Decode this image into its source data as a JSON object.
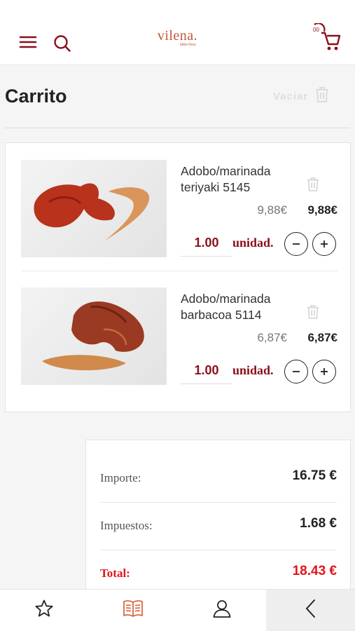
{
  "header": {
    "logo_text": "vilena.",
    "logo_sub": "fabio fresc",
    "cart_count": "00",
    "brand_color": "#8a0f1a",
    "logo_color": "#c2553b"
  },
  "cart": {
    "title": "Carrito",
    "empty_label": "Vaciar",
    "items": [
      {
        "name": "Adobo/marinada teriyaki 5145",
        "old_price": "9,88€",
        "price": "9,88€",
        "quantity": "1.00",
        "unit": "unidad."
      },
      {
        "name": "Adobo/marinada barbacoa 5114",
        "old_price": "6,87€",
        "price": "6,87€",
        "quantity": "1.00",
        "unit": "unidad."
      }
    ]
  },
  "summary": {
    "importe_label": "Importe:",
    "importe_value": "16.75 €",
    "impuestos_label": "Impuestos:",
    "impuestos_value": "1.68 €",
    "total_label": "Total:",
    "total_value": "18.43 €",
    "total_color": "#e2141b"
  },
  "nav": {
    "items": [
      "star-icon",
      "book-icon",
      "user-icon",
      "chevron-left-icon"
    ],
    "active_color": "#d76a45"
  }
}
